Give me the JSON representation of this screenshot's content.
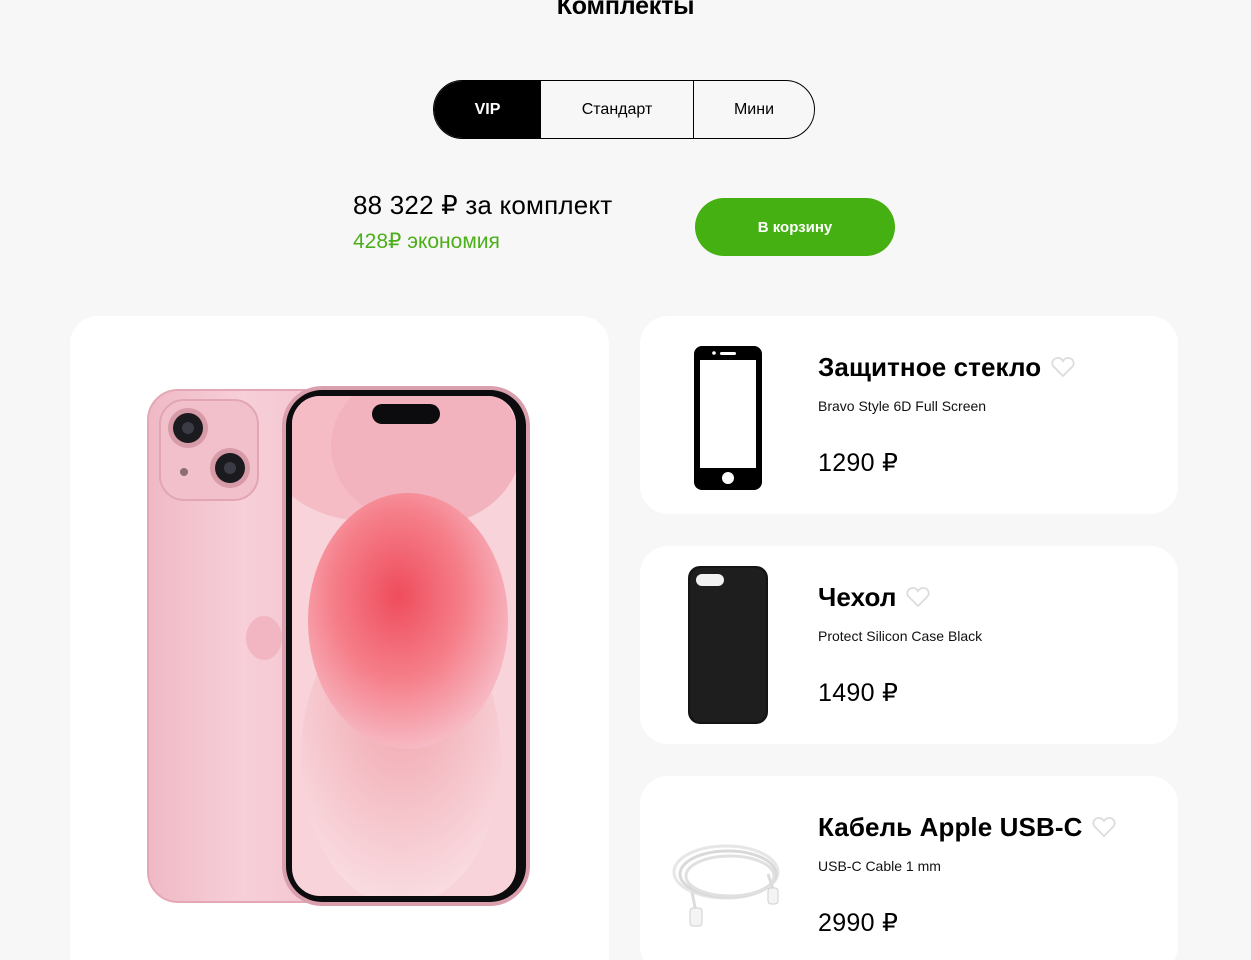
{
  "section": {
    "title": "Комплекты"
  },
  "tabs": [
    {
      "label": "VIP",
      "active": true
    },
    {
      "label": "Стандарт",
      "active": false
    },
    {
      "label": "Мини",
      "active": false
    }
  ],
  "price": {
    "total": "88 322 ₽ за комплект",
    "savings": "428₽ экономия"
  },
  "cart_button": {
    "label": "В корзину"
  },
  "colors": {
    "accent_green": "#45b012",
    "savings_green": "#4caf1a",
    "background": "#f7f7f7",
    "card": "#ffffff"
  },
  "items": [
    {
      "name": "Защитное стекло",
      "subtitle": "Bravo Style 6D Full Screen",
      "price": "1290 ₽",
      "icon": "screen-protector-image"
    },
    {
      "name": "Чехол",
      "subtitle": "Protect Silicon Case Black",
      "price": "1490 ₽",
      "icon": "phone-case-image"
    },
    {
      "name": "Кабель Apple USB-C",
      "subtitle": "USB-C Cable 1 mm",
      "price": "2990 ₽",
      "icon": "usb-c-cable-image"
    }
  ]
}
